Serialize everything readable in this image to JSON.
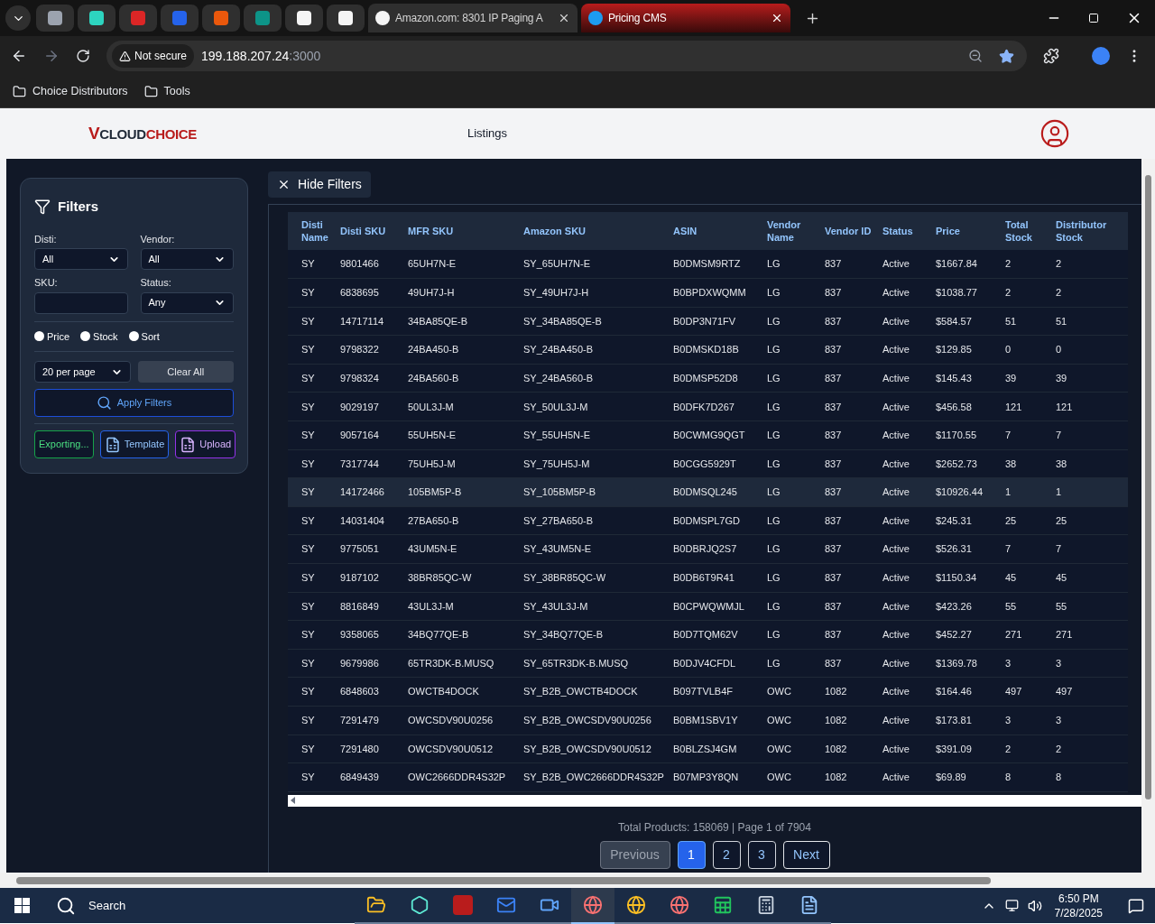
{
  "browser": {
    "tabs": [
      {
        "kind": "pinned",
        "selected": false,
        "color": "#9ca3af"
      },
      {
        "kind": "pinned",
        "selected": false,
        "color": "#2dd4bf"
      },
      {
        "kind": "pinned",
        "selected": false,
        "color": "#dc2626"
      },
      {
        "kind": "pinned",
        "selected": false,
        "color": "#2563eb"
      },
      {
        "kind": "pinned",
        "selected": false,
        "color": "#ea580c"
      },
      {
        "kind": "pinned",
        "selected": false,
        "color": "#0d9488"
      },
      {
        "kind": "pinned",
        "selected": false,
        "color": "#f5f5f5"
      },
      {
        "kind": "pinned",
        "selected": false,
        "color": "#f5f5f5"
      },
      {
        "kind": "page",
        "title": "Amazon.com: 8301 IP Paging A",
        "selected": false,
        "color": "#f5f5f5"
      },
      {
        "kind": "page",
        "title": "Pricing CMS",
        "selected": true,
        "color": "#1d9bf0"
      }
    ],
    "security": "Not secure",
    "url_host": "199.188.207.24",
    "url_port": ":3000",
    "bookmarks": [
      "Choice Distributors",
      "Tools"
    ]
  },
  "header": {
    "logo": {
      "mark": "V",
      "first": "CLOUD",
      "second": "CHOICE"
    },
    "title": "Listings"
  },
  "filters": {
    "title": "Filters",
    "hide_button": "Hide Filters",
    "fields": [
      {
        "label": "Disti:",
        "kind": "select",
        "value": "All"
      },
      {
        "label": "Vendor:",
        "kind": "select",
        "value": "All"
      },
      {
        "label": "SKU:",
        "kind": "text"
      },
      {
        "label": "Status:",
        "kind": "select",
        "value": "Any"
      }
    ],
    "radios": [
      {
        "label": "Price",
        "checked": false
      },
      {
        "label": "Stock",
        "checked": false
      },
      {
        "label": "Sort",
        "checked": false
      }
    ],
    "per_page": "20 per page",
    "clear": "Clear All",
    "apply": "Apply Filters",
    "actions": [
      {
        "label": "Exporting...",
        "kind": "export"
      },
      {
        "label": "Template",
        "kind": "template"
      },
      {
        "label": "Upload",
        "kind": "upload"
      }
    ]
  },
  "table": {
    "columns": [
      "Disti Name",
      "Disti SKU",
      "MFR SKU",
      "Amazon SKU",
      "ASIN",
      "Vendor Name",
      "Vendor ID",
      "Status",
      "Price",
      "Total Stock",
      "Distributor Stock"
    ],
    "rows": [
      {
        "highlighted": false,
        "cells": [
          "SY",
          "9801466",
          "65UH7N-E",
          "SY_65UH7N-E",
          "B0DMSM9RTZ",
          "LG",
          "837",
          "Active",
          "$1667.84",
          "2",
          "2"
        ]
      },
      {
        "highlighted": false,
        "cells": [
          "SY",
          "6838695",
          "49UH7J-H",
          "SY_49UH7J-H",
          "B0BPDXWQMM",
          "LG",
          "837",
          "Active",
          "$1038.77",
          "2",
          "2"
        ]
      },
      {
        "highlighted": false,
        "cells": [
          "SY",
          "14717114",
          "34BA85QE-B",
          "SY_34BA85QE-B",
          "B0DP3N71FV",
          "LG",
          "837",
          "Active",
          "$584.57",
          "51",
          "51"
        ]
      },
      {
        "highlighted": false,
        "cells": [
          "SY",
          "9798322",
          "24BA450-B",
          "SY_24BA450-B",
          "B0DMSKD18B",
          "LG",
          "837",
          "Active",
          "$129.85",
          "0",
          "0"
        ]
      },
      {
        "highlighted": false,
        "cells": [
          "SY",
          "9798324",
          "24BA560-B",
          "SY_24BA560-B",
          "B0DMSP52D8",
          "LG",
          "837",
          "Active",
          "$145.43",
          "39",
          "39"
        ]
      },
      {
        "highlighted": false,
        "cells": [
          "SY",
          "9029197",
          "50UL3J-M",
          "SY_50UL3J-M",
          "B0DFK7D267",
          "LG",
          "837",
          "Active",
          "$456.58",
          "121",
          "121"
        ]
      },
      {
        "highlighted": false,
        "cells": [
          "SY",
          "9057164",
          "55UH5N-E",
          "SY_55UH5N-E",
          "B0CWMG9QGT",
          "LG",
          "837",
          "Active",
          "$1170.55",
          "7",
          "7"
        ]
      },
      {
        "highlighted": false,
        "cells": [
          "SY",
          "7317744",
          "75UH5J-M",
          "SY_75UH5J-M",
          "B0CGG5929T",
          "LG",
          "837",
          "Active",
          "$2652.73",
          "38",
          "38"
        ]
      },
      {
        "highlighted": true,
        "cells": [
          "SY",
          "14172466",
          "105BM5P-B",
          "SY_105BM5P-B",
          "B0DMSQL245",
          "LG",
          "837",
          "Active",
          "$10926.44",
          "1",
          "1"
        ]
      },
      {
        "highlighted": false,
        "cells": [
          "SY",
          "14031404",
          "27BA650-B",
          "SY_27BA650-B",
          "B0DMSPL7GD",
          "LG",
          "837",
          "Active",
          "$245.31",
          "25",
          "25"
        ]
      },
      {
        "highlighted": false,
        "cells": [
          "SY",
          "9775051",
          "43UM5N-E",
          "SY_43UM5N-E",
          "B0DBRJQ2S7",
          "LG",
          "837",
          "Active",
          "$526.31",
          "7",
          "7"
        ]
      },
      {
        "highlighted": false,
        "cells": [
          "SY",
          "9187102",
          "38BR85QC-W",
          "SY_38BR85QC-W",
          "B0DB6T9R41",
          "LG",
          "837",
          "Active",
          "$1150.34",
          "45",
          "45"
        ]
      },
      {
        "highlighted": false,
        "cells": [
          "SY",
          "8816849",
          "43UL3J-M",
          "SY_43UL3J-M",
          "B0CPWQWMJL",
          "LG",
          "837",
          "Active",
          "$423.26",
          "55",
          "55"
        ]
      },
      {
        "highlighted": false,
        "cells": [
          "SY",
          "9358065",
          "34BQ77QE-B",
          "SY_34BQ77QE-B",
          "B0D7TQM62V",
          "LG",
          "837",
          "Active",
          "$452.27",
          "271",
          "271"
        ]
      },
      {
        "highlighted": false,
        "cells": [
          "SY",
          "9679986",
          "65TR3DK-B.MUSQ",
          "SY_65TR3DK-B.MUSQ",
          "B0DJV4CFDL",
          "LG",
          "837",
          "Active",
          "$1369.78",
          "3",
          "3"
        ]
      },
      {
        "highlighted": false,
        "cells": [
          "SY",
          "6848603",
          "OWCTB4DOCK",
          "SY_B2B_OWCTB4DOCK",
          "B097TVLB4F",
          "OWC",
          "1082",
          "Active",
          "$164.46",
          "497",
          "497"
        ]
      },
      {
        "highlighted": false,
        "cells": [
          "SY",
          "7291479",
          "OWCSDV90U0256",
          "SY_B2B_OWCSDV90U0256",
          "B0BM1SBV1Y",
          "OWC",
          "1082",
          "Active",
          "$173.81",
          "3",
          "3"
        ]
      },
      {
        "highlighted": false,
        "cells": [
          "SY",
          "7291480",
          "OWCSDV90U0512",
          "SY_B2B_OWCSDV90U0512",
          "B0BLZSJ4GM",
          "OWC",
          "1082",
          "Active",
          "$391.09",
          "2",
          "2"
        ]
      },
      {
        "highlighted": false,
        "cells": [
          "SY",
          "6849439",
          "OWC2666DDR4S32P",
          "SY_B2B_OWC2666DDR4S32P",
          "B07MP3Y8QN",
          "OWC",
          "1082",
          "Active",
          "$69.89",
          "8",
          "8"
        ]
      }
    ]
  },
  "pagination": {
    "summary": "Total Products: 158069 | Page 1 of 7904",
    "previous": {
      "label": "Previous",
      "disabled": true
    },
    "pages": [
      {
        "label": "1",
        "selected": true
      },
      {
        "label": "2",
        "selected": false
      },
      {
        "label": "3",
        "selected": false
      }
    ],
    "next": {
      "label": "Next",
      "disabled": false
    }
  },
  "taskbar": {
    "search": "Search",
    "time": "6:50 PM",
    "date": "7/28/2025"
  }
}
